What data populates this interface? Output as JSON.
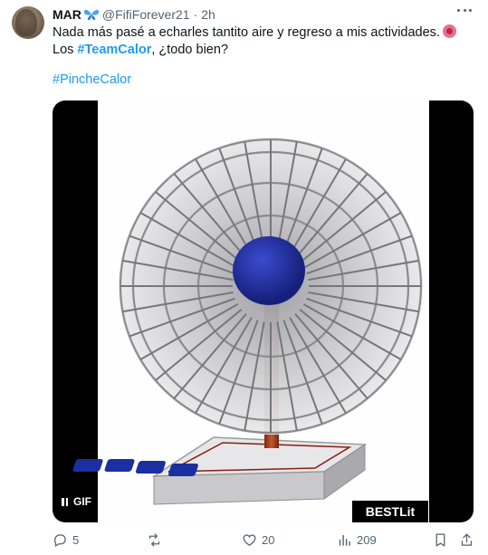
{
  "tweet": {
    "display_name": "MAR",
    "handle": "@FifiForever21",
    "separator": "·",
    "time": "2h",
    "text_line1": "Nada más pasé a echarles tantito aire y regreso a mis actividades.",
    "text_line2_prefix": "Los ",
    "text_line2_tag": "#TeamCalor",
    "text_line2_suffix": ", ¿todo bien?",
    "hashtag": "#PincheCalor",
    "media": {
      "badge": "GIF",
      "watermark": "BESTLit"
    }
  },
  "actions": {
    "replies": "5",
    "retweets": "",
    "likes": "20",
    "views": "209"
  },
  "colors": {
    "link": "#1d9bf0",
    "secondary_text": "#536471",
    "fan_hub": "#1f2a9e"
  },
  "icons": {
    "verified_like": "butterfly-icon",
    "more": "more-icon",
    "reply": "reply-icon",
    "retweet": "retweet-icon",
    "like": "heart-icon",
    "views": "views-icon",
    "bookmark": "bookmark-icon",
    "share": "share-icon"
  }
}
